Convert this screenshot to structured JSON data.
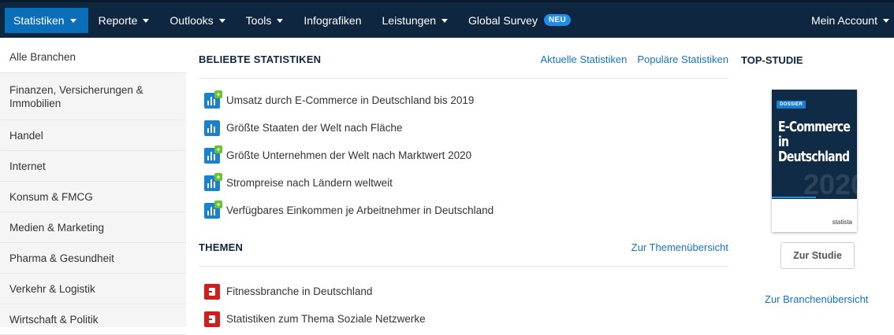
{
  "nav": {
    "items": [
      {
        "label": "Statistiken",
        "caret": true,
        "active": true
      },
      {
        "label": "Reporte",
        "caret": true
      },
      {
        "label": "Outlooks",
        "caret": true
      },
      {
        "label": "Tools",
        "caret": true
      },
      {
        "label": "Infografiken",
        "caret": false
      },
      {
        "label": "Leistungen",
        "caret": true
      },
      {
        "label": "Global Survey",
        "caret": false,
        "badge": "NEU"
      }
    ],
    "account": "Mein Account"
  },
  "sidebar": {
    "items": [
      "Alle Branchen",
      "Finanzen, Versicherungen & Immobilien",
      "Handel",
      "Internet",
      "Konsum & FMCG",
      "Medien & Marketing",
      "Pharma & Gesundheit",
      "Verkehr & Logistik",
      "Wirtschaft & Politik"
    ]
  },
  "popular": {
    "title": "BELIEBTE STATISTIKEN",
    "link_current": "Aktuelle Statistiken",
    "link_popular": "Populäre Statistiken",
    "items": [
      {
        "text": "Umsatz durch E-Commerce in Deutschland bis 2019",
        "premium": true
      },
      {
        "text": "Größte Staaten der Welt nach Fläche",
        "premium": false
      },
      {
        "text": "Größte Unternehmen der Welt nach Marktwert 2020",
        "premium": true
      },
      {
        "text": "Strompreise nach Ländern weltweit",
        "premium": true
      },
      {
        "text": "Verfügbares Einkommen je Arbeitnehmer in Deutschland",
        "premium": true
      }
    ]
  },
  "topics": {
    "title": "THEMEN",
    "link": "Zur Themenübersicht",
    "items": [
      "Fitnessbranche in Deutschland",
      "Statistiken zum Thema Soziale Netzwerke"
    ]
  },
  "top_study": {
    "title": "TOP-STUDIE",
    "cover_tag": "DOSSIER",
    "cover_title": "E-Commerce in Deutschland",
    "cover_year": "2020",
    "cover_brand": "statista",
    "button": "Zur Studie",
    "branch_link": "Zur Branchenübersicht"
  },
  "colors": {
    "nav_bg": "#0f2640",
    "nav_active": "#0a6fb8",
    "link": "#1473c4",
    "stat_icon": "#1882d0",
    "premium_plus": "#69c12b",
    "topic_icon": "#d21d1d"
  }
}
